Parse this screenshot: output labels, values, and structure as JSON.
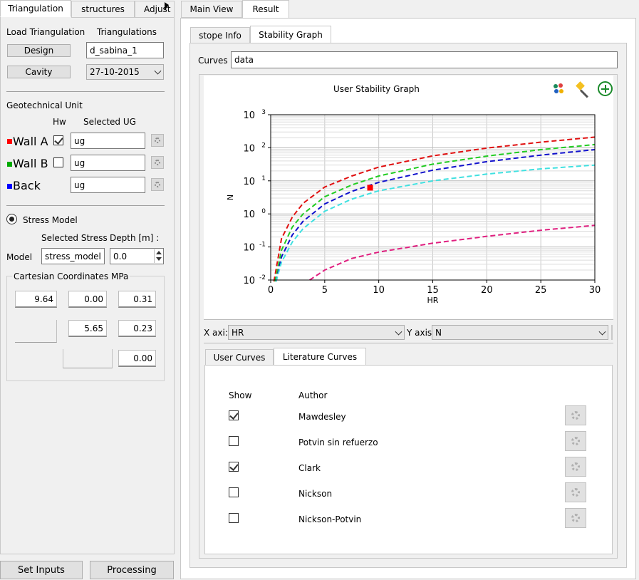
{
  "left_tabs": [
    "Triangulation",
    "structures",
    "Adjust"
  ],
  "right_tabs": [
    "Main View",
    "Result"
  ],
  "sub_tabs": [
    "stope Info",
    "Stability Graph"
  ],
  "load_triangulation": {
    "label": "Load Triangulation",
    "triangulations_label": "Triangulations",
    "design_button": "Design",
    "design_value": "d_sabina_1",
    "cavity_button": "Cavity",
    "cavity_value": "27-10-2015"
  },
  "geotechnical": {
    "title": "Geotechnical Unit",
    "hw_label": "Hw",
    "selected_ug_label": "Selected UG",
    "rows": [
      {
        "name": "Wall A",
        "color": "#ff0000",
        "checked": true,
        "value": "ug"
      },
      {
        "name": "Wall B",
        "color": "#00aa00",
        "checked": false,
        "value": "ug"
      },
      {
        "name": "Back",
        "color": "#0000ff",
        "checked": false,
        "value": "ug"
      }
    ]
  },
  "stress": {
    "title": "Stress Model",
    "selected_stress_label": "Selected Stress",
    "depth_label": "Depth [m] :",
    "model_label": "Model",
    "model_value": "stress_model",
    "depth_value": "0.0",
    "cartesian_label": "Cartesian Coordinates MPa",
    "matrix": [
      [
        "9.64",
        "0.00",
        "0.31"
      ],
      [
        "",
        "5.65",
        "0.23"
      ],
      [
        "",
        "",
        "0.00"
      ]
    ]
  },
  "bottom_buttons": {
    "set_inputs": "Set Inputs",
    "processing": "Processing"
  },
  "curves_label": "Curves",
  "curves_value": "data",
  "x_axis_label": "X axi:",
  "x_axis_value": "HR",
  "y_axis_label": "Y axis",
  "y_axis_value": "N",
  "curve_tabs": [
    "User Curves",
    "Literature Curves"
  ],
  "literature": {
    "show_label": "Show",
    "author_label": "Author",
    "items": [
      {
        "author": "Mawdesley",
        "checked": true
      },
      {
        "author": "Potvin sin refuerzo",
        "checked": false
      },
      {
        "author": "Clark",
        "checked": true
      },
      {
        "author": "Nickson",
        "checked": false
      },
      {
        "author": "Nickson-Potvin",
        "checked": false
      }
    ]
  },
  "chart_data": {
    "type": "line",
    "title": "User Stability Graph",
    "xlabel": "HR",
    "ylabel": "N",
    "xlim": [
      0,
      30
    ],
    "ylim_log10": [
      -2,
      3
    ],
    "y_scale": "log",
    "grid": true,
    "x_ticks": [
      "0",
      "5",
      "10",
      "15",
      "20",
      "25",
      "30"
    ],
    "y_ticks": [
      "10",
      "10",
      "10",
      "10",
      "10",
      "10"
    ],
    "y_tick_exponents": [
      "-2",
      "-1",
      "0",
      "1",
      "2",
      "3"
    ],
    "series": [
      {
        "color": "#e01010",
        "x": [
          0.3,
          1,
          2,
          3,
          5,
          7.5,
          10,
          15,
          20,
          25,
          30
        ],
        "y": [
          0.009,
          0.18,
          0.8,
          2.1,
          6.5,
          14,
          26,
          57,
          98,
          148,
          210
        ]
      },
      {
        "color": "#22cc22",
        "x": [
          0.4,
          1,
          2,
          3,
          5,
          7.5,
          10,
          15,
          20,
          25,
          30
        ],
        "y": [
          0.009,
          0.08,
          0.4,
          1.0,
          3.3,
          7.5,
          14,
          32,
          56,
          88,
          125
        ]
      },
      {
        "color": "#1010cc",
        "x": [
          0.5,
          1,
          2,
          3,
          5,
          7.5,
          10,
          15,
          20,
          25,
          30
        ],
        "y": [
          0.009,
          0.05,
          0.23,
          0.6,
          2.0,
          4.8,
          9,
          21,
          38,
          60,
          88
        ]
      },
      {
        "color": "#40e0e0",
        "x": [
          0.5,
          1,
          2,
          3,
          5,
          7.5,
          10,
          15,
          20,
          25,
          30
        ],
        "y": [
          0.009,
          0.035,
          0.14,
          0.36,
          1.2,
          2.8,
          5,
          10,
          16,
          23,
          30
        ]
      },
      {
        "color": "#e02080",
        "x": [
          3.6,
          5,
          7.5,
          10,
          15,
          20,
          25,
          30
        ],
        "y": [
          0.01,
          0.02,
          0.045,
          0.07,
          0.13,
          0.21,
          0.32,
          0.45
        ]
      }
    ],
    "points": [
      {
        "x": 9.2,
        "y": 6.2,
        "color": "#ff0000"
      }
    ]
  }
}
